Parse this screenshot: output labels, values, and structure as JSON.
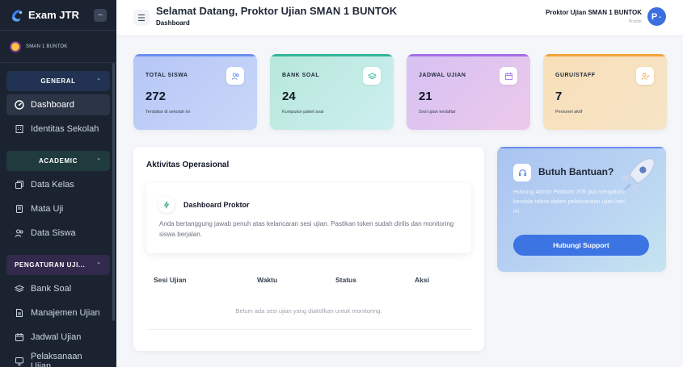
{
  "sidebar": {
    "brand": "Exam JTR",
    "school_name": "SMAN 1 BUNTOK",
    "groups": [
      {
        "label": "GENERAL",
        "items": [
          "Dashboard",
          "Identitas Sekolah"
        ]
      },
      {
        "label": "ACADEMIC",
        "items": [
          "Data Kelas",
          "Mata Uji",
          "Data Siswa"
        ]
      },
      {
        "label": "PENGATURAN UJI...",
        "items": [
          "Bank Soal",
          "Manajemen Ujian",
          "Jadwal Ujian",
          "Pelaksanaan Ujian"
        ]
      }
    ],
    "active_item": "Dashboard"
  },
  "header": {
    "title": "Selamat Datang, Proktor Ujian SMAN 1 BUNTOK",
    "subtitle": "Dashboard",
    "user_name": "Proktor Ujian SMAN 1 BUNTOK",
    "user_role": "Proctor",
    "avatar_initial": "P"
  },
  "stats": [
    {
      "label": "TOTAL SISWA",
      "value": "272",
      "desc": "Terdaftar di sekolah ini",
      "icon": "users-icon",
      "accent": "#6b8ef0"
    },
    {
      "label": "BANK SOAL",
      "value": "24",
      "desc": "Kumpulan paket soal",
      "icon": "layers-icon",
      "accent": "#36b49a"
    },
    {
      "label": "JADWAL UJIAN",
      "value": "21",
      "desc": "Sesi ujian terdaftar",
      "icon": "calendar-icon",
      "accent": "#a56ee8"
    },
    {
      "label": "GURU/STAFF",
      "value": "7",
      "desc": "Personel aktif",
      "icon": "user-check-icon",
      "accent": "#f1a33b"
    }
  ],
  "activity": {
    "title": "Aktivitas Operasional",
    "card_title": "Dashboard Proktor",
    "card_desc": "Anda bertanggung jawab penuh atas kelancaran sesi ujian. Pastikan token sudah dirilis dan monitoring siswa berjalan.",
    "columns": [
      "Sesi Ujian",
      "Waktu",
      "Status",
      "Aksi"
    ],
    "empty_message": "Belum ada sesi ujian yang diaktifkan untuk monitoring."
  },
  "help": {
    "title": "Butuh Bantuan?",
    "desc": "Hubungi Admin Platform JTR jika mengalami kendala teknis dalam pelaksanaan ujian hari ini.",
    "button_label": "Hubungi Support"
  }
}
